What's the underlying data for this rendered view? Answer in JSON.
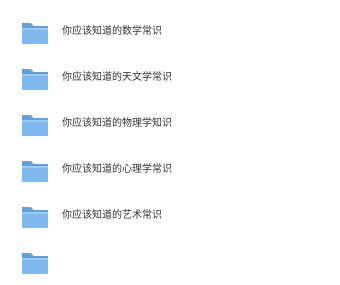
{
  "files": [
    {
      "name": "你应该知道的数学常识",
      "icon": "folder-icon"
    },
    {
      "name": "你应该知道的天文学常识",
      "icon": "folder-icon"
    },
    {
      "name": "你应该知道的物理学知识",
      "icon": "folder-icon"
    },
    {
      "name": "你应该知道的心理学常识",
      "icon": "folder-icon"
    },
    {
      "name": "你应该知道的艺术常识",
      "icon": "folder-icon"
    },
    {
      "name": "",
      "icon": "folder-icon"
    }
  ],
  "colors": {
    "folder_body": "#7fb8ec",
    "folder_back": "#5fa1dd",
    "folder_tab": "#6aaae4",
    "text": "#333333",
    "background": "#ffffff"
  }
}
